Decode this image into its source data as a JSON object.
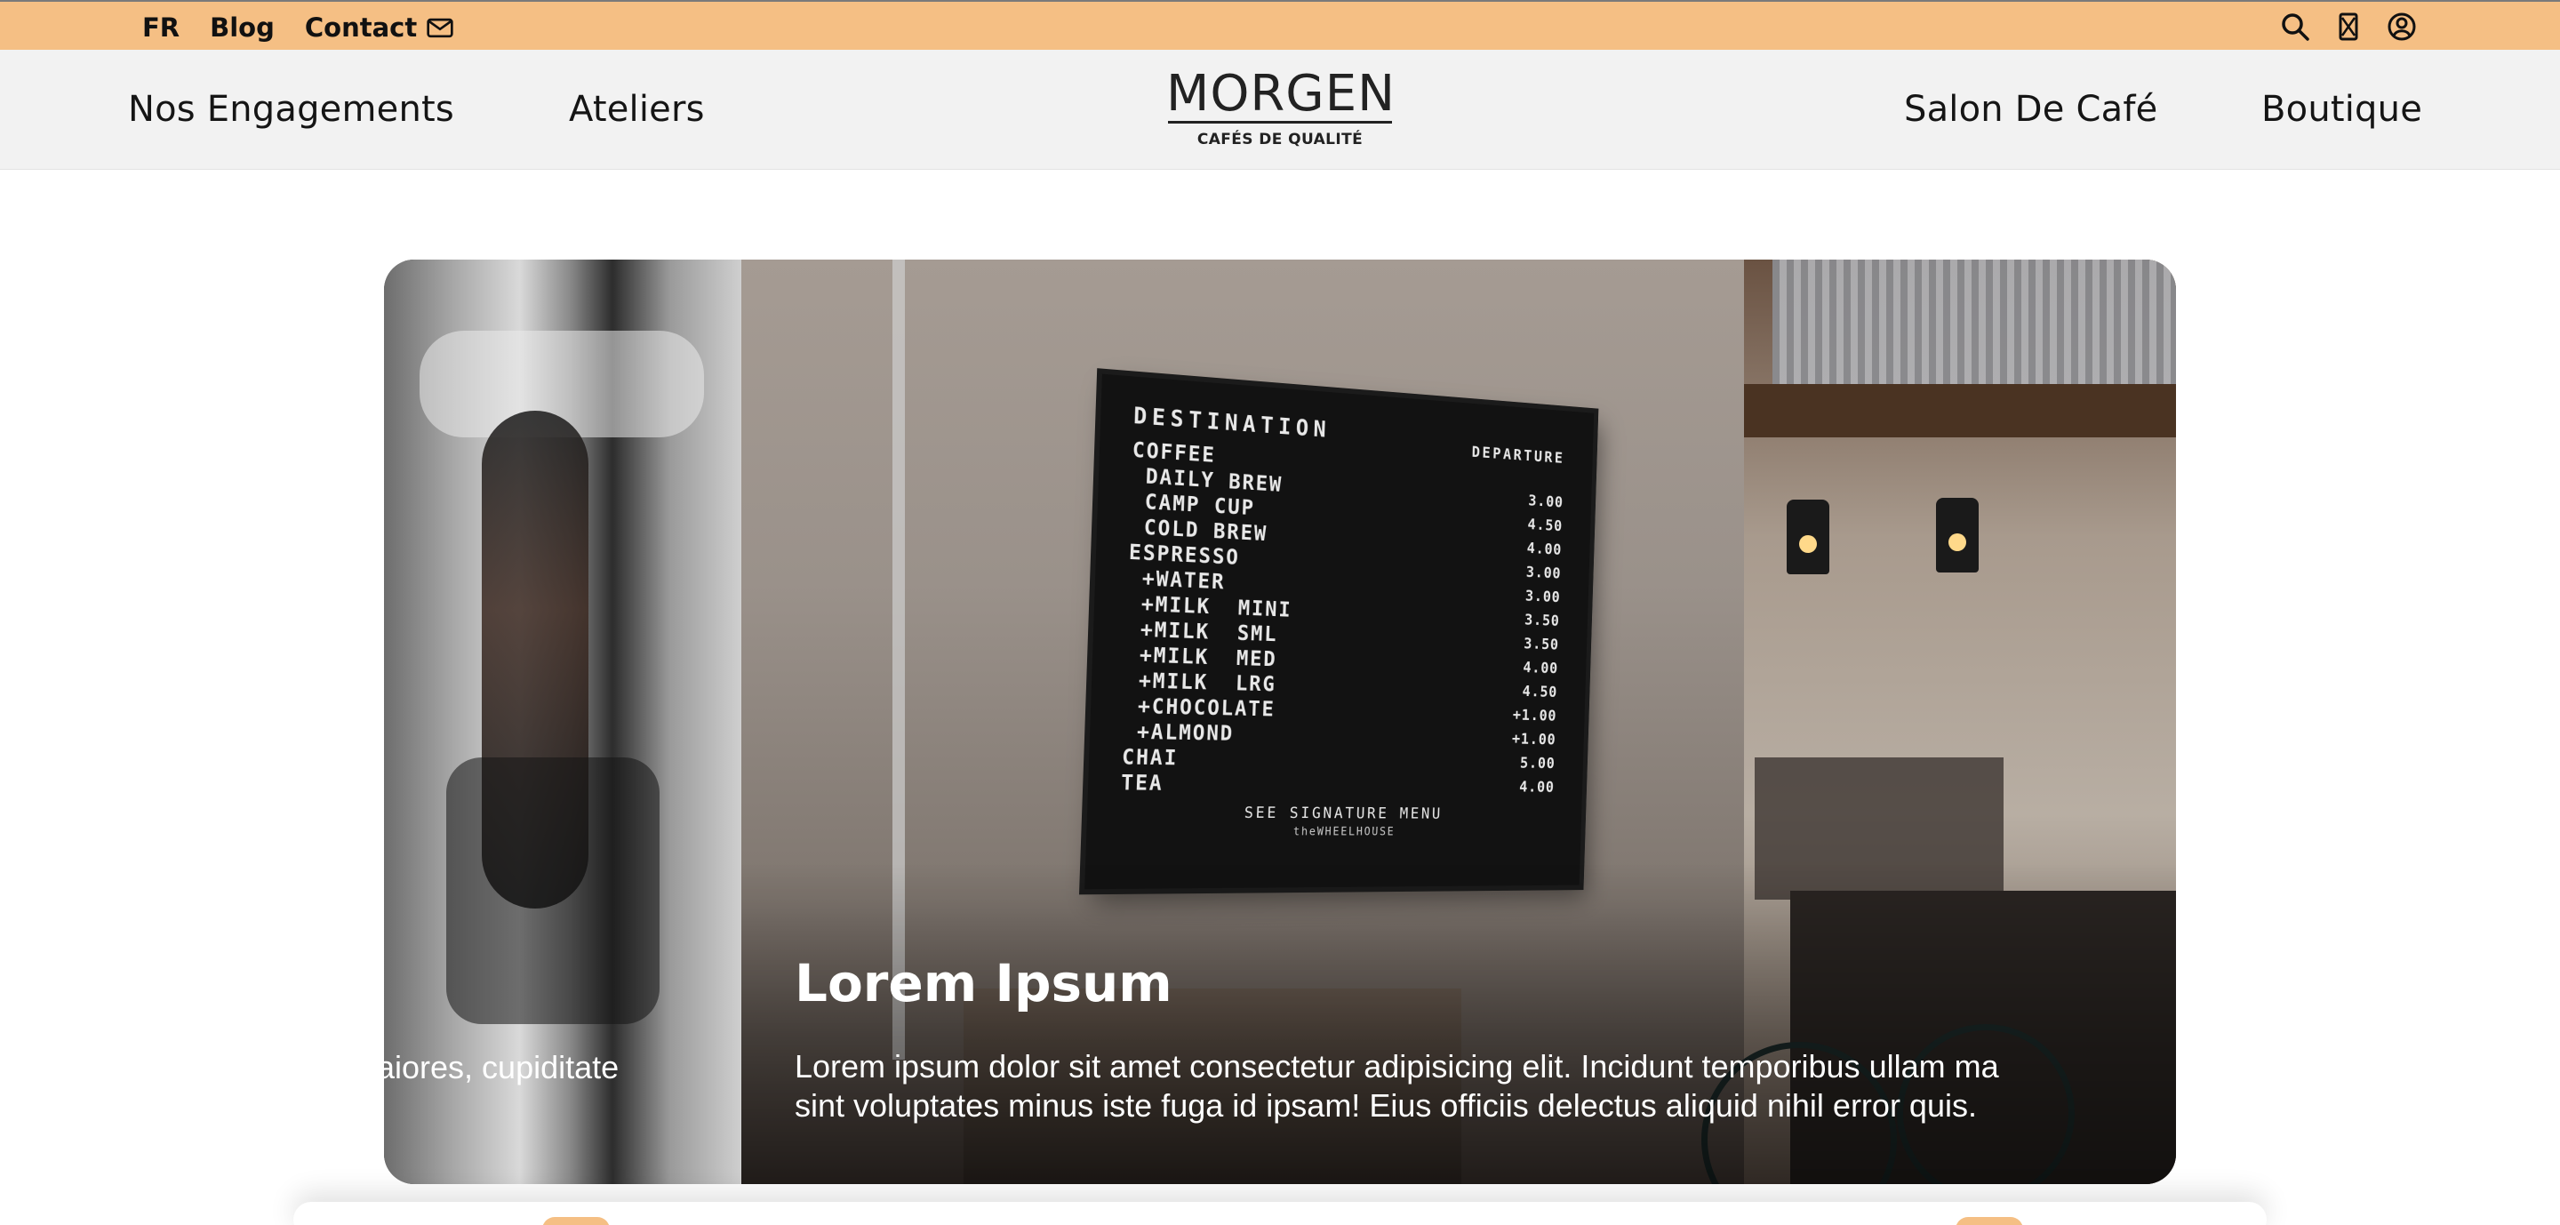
{
  "topbar": {
    "lang": "FR",
    "blog": "Blog",
    "contact": "Contact",
    "icons": [
      "search-icon",
      "coffee-bag-icon",
      "account-icon"
    ]
  },
  "nav": {
    "left": [
      "Nos Engagements",
      "Ateliers"
    ],
    "right": [
      "Salon De Café",
      "Boutique"
    ],
    "logo": {
      "brand": "MORGEN",
      "tagline": "CAFÉS DE QUALITÉ"
    }
  },
  "carousel": {
    "prev_caption": "aiores, cupiditate",
    "slide": {
      "title": "Lorem Ipsum",
      "text_line1": "Lorem ipsum dolor sit amet consectetur adipisicing elit. Incidunt temporibus ullam ma",
      "text_line2": "sint voluptates minus iste fuga id ipsam! Eius officiis delectus aliquid nihil error quis."
    },
    "board": {
      "head_left": "DESTINATION",
      "head_right": "DEPARTURE",
      "rows": [
        {
          "item": "COFFEE",
          "price": ""
        },
        {
          "item": " DAILY BREW",
          "price": "3.00"
        },
        {
          "item": " CAMP CUP",
          "price": "4.50"
        },
        {
          "item": " COLD BREW",
          "price": "4.00"
        },
        {
          "item": "ESPRESSO",
          "price": "3.00"
        },
        {
          "item": " +WATER",
          "price": "3.00"
        },
        {
          "item": " +MILK  MINI",
          "price": "3.50"
        },
        {
          "item": " +MILK  SML",
          "price": "3.50"
        },
        {
          "item": " +MILK  MED",
          "price": "4.00"
        },
        {
          "item": " +MILK  LRG",
          "price": "4.50"
        },
        {
          "item": " +CHOCOLATE",
          "price": "+1.00"
        },
        {
          "item": " +ALMOND",
          "price": "+1.00"
        },
        {
          "item": "CHAI",
          "price": "5.00"
        },
        {
          "item": "TEA",
          "price": "4.00"
        }
      ],
      "footer": "SEE SIGNATURE MENU",
      "mark": "theWHEELHOUSE"
    }
  },
  "colors": {
    "accent": "#f5bf84",
    "nav_bg": "#f2f2f2"
  }
}
